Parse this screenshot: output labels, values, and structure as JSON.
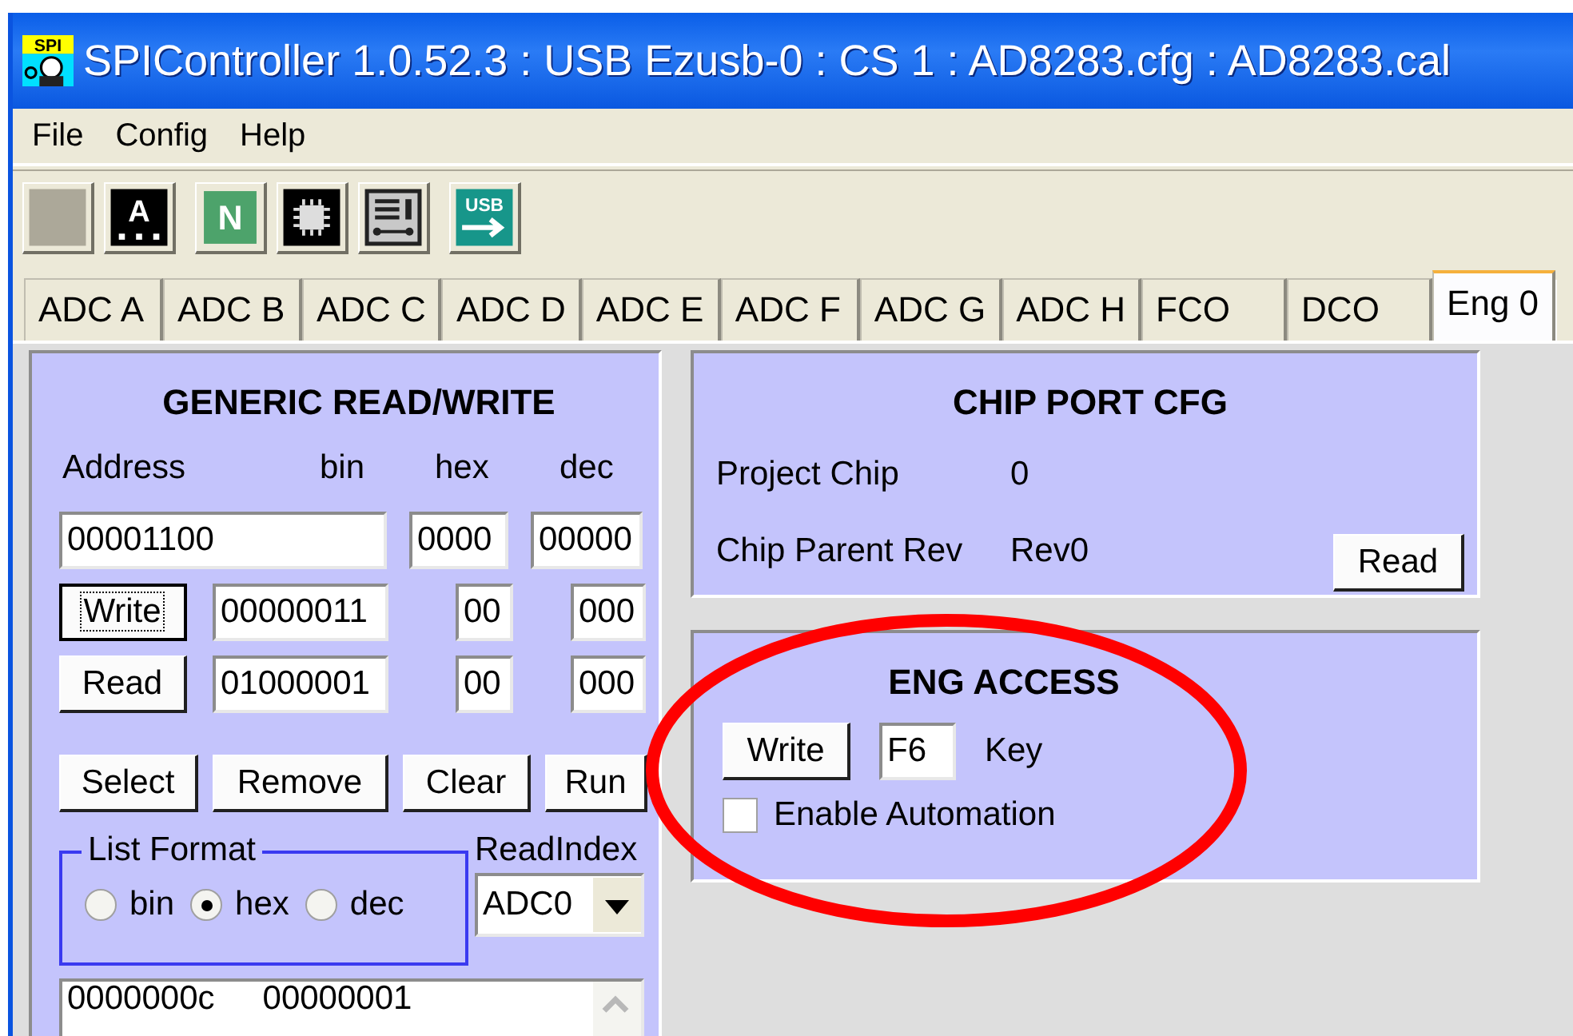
{
  "window": {
    "icon_text": "SPI",
    "title": "SPIController 1.0.52.3 : USB Ezusb-0 : CS 1 : AD8283.cfg : AD8283.cal"
  },
  "menu": [
    "File",
    "Config",
    "Help"
  ],
  "toolbar": [
    {
      "kind": "blank"
    },
    {
      "kind": "chip-letter",
      "glyph": "A"
    },
    {
      "kind": "letter",
      "glyph": "N"
    },
    {
      "kind": "chip"
    },
    {
      "kind": "panel"
    },
    {
      "kind": "usb",
      "glyph": "USB"
    }
  ],
  "tabs": [
    {
      "label": "ADC A",
      "selected": false
    },
    {
      "label": "ADC B",
      "selected": false
    },
    {
      "label": "ADC C",
      "selected": false
    },
    {
      "label": "ADC D",
      "selected": false
    },
    {
      "label": "ADC E",
      "selected": false
    },
    {
      "label": "ADC F",
      "selected": false
    },
    {
      "label": "ADC G",
      "selected": false
    },
    {
      "label": "ADC H",
      "selected": false
    },
    {
      "label": "FCO",
      "selected": false
    },
    {
      "label": "DCO",
      "selected": false
    },
    {
      "label": "Eng 0",
      "selected": true
    }
  ],
  "generic_rw": {
    "title": "GENERIC READ/WRITE",
    "headers": {
      "address": "Address",
      "bin": "bin",
      "hex": "hex",
      "dec": "dec"
    },
    "address": {
      "bin": "00001100",
      "hex": "0000",
      "dec": "00000"
    },
    "rows": [
      {
        "button": "Write",
        "focused": true,
        "bin": "00000011",
        "hex": "00",
        "dec": "000"
      },
      {
        "button": "Read",
        "focused": false,
        "bin": "01000001",
        "hex": "00",
        "dec": "000"
      }
    ],
    "actions": [
      "Select",
      "Remove",
      "Clear",
      "Run"
    ],
    "list_format": {
      "legend": "List Format",
      "options": [
        {
          "label": "bin",
          "selected": false
        },
        {
          "label": "hex",
          "selected": true
        },
        {
          "label": "dec",
          "selected": false
        }
      ]
    },
    "read_index": {
      "label": "ReadIndex",
      "value": "ADC0"
    },
    "list_rows": [
      [
        "0000000c",
        "00000001"
      ]
    ]
  },
  "chip_port": {
    "title": "CHIP PORT CFG",
    "fields": [
      {
        "label": "Project Chip",
        "value": "0"
      },
      {
        "label": "Chip Parent Rev",
        "value": "Rev0"
      }
    ],
    "button": "Read"
  },
  "eng_access": {
    "title": "ENG ACCESS",
    "button": "Write",
    "key_value": "F6",
    "key_label": "Key",
    "automation": {
      "label": "Enable Automation",
      "checked": false
    }
  }
}
